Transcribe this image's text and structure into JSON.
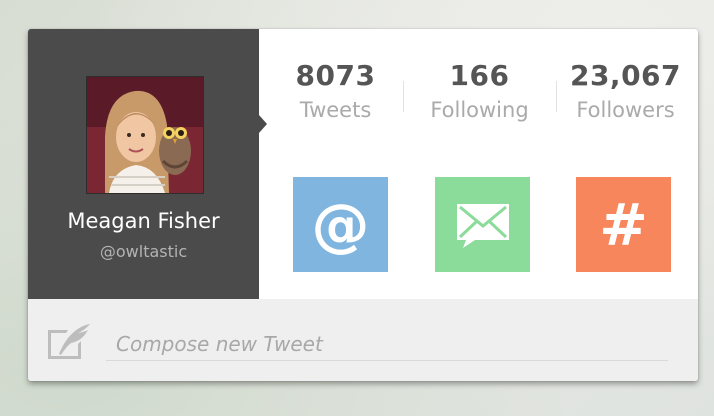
{
  "profile": {
    "name": "Meagan Fisher",
    "handle": "@owltastic"
  },
  "stats": [
    {
      "value": "8073",
      "label": "Tweets"
    },
    {
      "value": "166",
      "label": "Following"
    },
    {
      "value": "23,067",
      "label": "Followers"
    }
  ],
  "actions": {
    "mention_glyph": "@",
    "hashtag_glyph": "#"
  },
  "compose": {
    "placeholder": "Compose new Tweet"
  },
  "icons": {
    "quill": "quill-icon",
    "mail": "envelope-icon"
  },
  "colors": {
    "profile_bg": "#4b4b4b",
    "mention_tile": "#7fb5de",
    "mail_tile": "#8bdb9a",
    "hash_tile": "#f7865d",
    "compose_bg": "#efefef"
  }
}
